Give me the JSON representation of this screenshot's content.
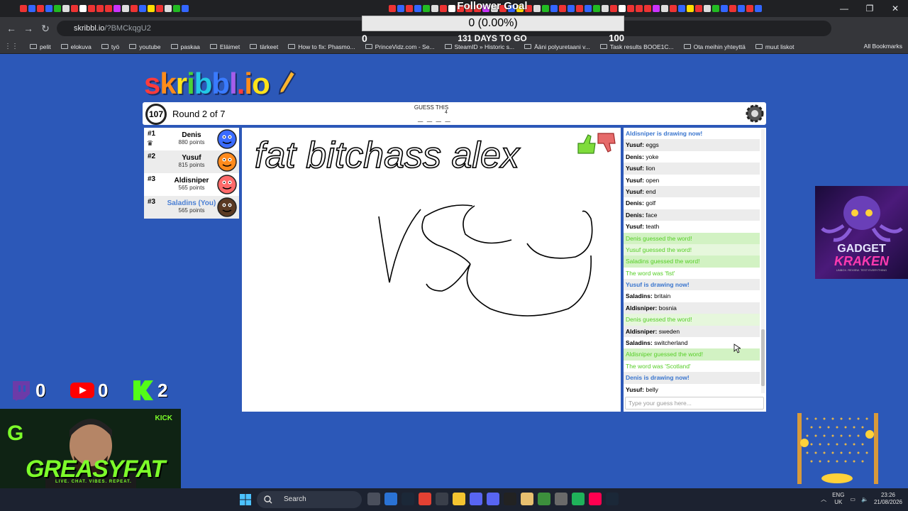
{
  "browser": {
    "url_domain": "skribbl.io",
    "url_path": "/?BMCkqgU2",
    "bookmarks": [
      "pelit",
      "elokuva",
      "työ",
      "youtube",
      "paskaa",
      "Eläimet",
      "tärkeet",
      "How to fix: Phasmo...",
      "PrinceVidz.com - Se...",
      "SteamID » Historic s...",
      "Ääni polyuretaani v...",
      "Task results BOOE1C...",
      "Ota meihin yhteyttä",
      "muut liskot"
    ],
    "all_bookmarks": "All Bookmarks"
  },
  "goal": {
    "title": "Follower Goal",
    "progress_text": "0 (0.00%)",
    "progress": 0,
    "min": "0",
    "days_left": "131 DAYS TO GO",
    "max": "100"
  },
  "game": {
    "logo": [
      "s",
      "k",
      "r",
      "i",
      "b",
      "b",
      "l",
      ".",
      "i",
      "o"
    ],
    "logo_colors": [
      "#ff3b3b",
      "#ff8c1a",
      "#ffe21a",
      "#4cd137",
      "#22c8e5",
      "#3a7bff",
      "#a55eea",
      "#ff3b3b",
      "#ff8c1a",
      "#ffe21a"
    ],
    "timer": "107",
    "round": "Round 2 of 7",
    "guess_label": "GUESS THIS",
    "letter_count": "4",
    "blanks": "_ _ _ _",
    "players": [
      {
        "rank": "#1",
        "name": "Denis",
        "points": "880 points",
        "crown": true,
        "color": "#3a6bff",
        "you": false
      },
      {
        "rank": "#2",
        "name": "Yusuf",
        "points": "815 points",
        "crown": false,
        "color": "#ff8a1c",
        "you": false
      },
      {
        "rank": "#3",
        "name": "Aldisniper",
        "points": "565 points",
        "crown": false,
        "color": "#ff6a6a",
        "you": false
      },
      {
        "rank": "#3",
        "name": "Saladins (You)",
        "points": "565 points",
        "crown": false,
        "color": "#5a3a24",
        "you": true
      }
    ],
    "canvas_text": "fat bitchass alex"
  },
  "chat": {
    "messages": [
      {
        "type": "draw",
        "text": "Aldisniper is drawing now!"
      },
      {
        "type": "msg",
        "user": "Yusuf:",
        "text": "eggs"
      },
      {
        "type": "msg",
        "user": "Denis:",
        "text": "yoke"
      },
      {
        "type": "msg",
        "user": "Yusuf:",
        "text": "lion"
      },
      {
        "type": "msg",
        "user": "Yusuf:",
        "text": "open"
      },
      {
        "type": "msg",
        "user": "Yusuf:",
        "text": "end"
      },
      {
        "type": "msg",
        "user": "Denis:",
        "text": "golf"
      },
      {
        "type": "msg",
        "user": "Denis:",
        "text": "face"
      },
      {
        "type": "msg",
        "user": "Yusuf:",
        "text": "teath"
      },
      {
        "type": "guessed",
        "text": "Denis guessed the word!"
      },
      {
        "type": "guessed",
        "text": "Yusuf guessed the word!"
      },
      {
        "type": "guessed",
        "text": "Saladins guessed the word!"
      },
      {
        "type": "word",
        "text": "The word was 'fist'"
      },
      {
        "type": "draw",
        "text": "Yusuf is drawing now!"
      },
      {
        "type": "msg",
        "user": "Saladins:",
        "text": "britain"
      },
      {
        "type": "msg",
        "user": "Aldisniper:",
        "text": "bosnia"
      },
      {
        "type": "guessed",
        "text": "Denis guessed the word!"
      },
      {
        "type": "msg",
        "user": "Aldisniper:",
        "text": "sweden"
      },
      {
        "type": "msg",
        "user": "Saladins:",
        "text": "switcherland"
      },
      {
        "type": "guessed",
        "text": "Aldisniper guessed the word!"
      },
      {
        "type": "word",
        "text": "The word was 'Scotland'"
      },
      {
        "type": "draw",
        "text": "Denis is drawing now!"
      },
      {
        "type": "msg",
        "user": "Yusuf:",
        "text": "belly"
      }
    ],
    "placeholder": "Type your guess here..."
  },
  "overlay": {
    "twitch_count": "0",
    "youtube_count": "0",
    "kick_count": "2",
    "streamer_name": "GREASYFAT",
    "streamer_tagline": "LIVE. CHAT. VIBES. REPEAT.",
    "kick_label": "KICK",
    "sponsor_line1": "GADGET",
    "sponsor_line2": "KRAKEN",
    "sponsor_tagline": "UNBOX. REVIEW. TEST EVERYTHING"
  },
  "taskbar": {
    "search": "Search",
    "lang": "ENG",
    "region": "UK",
    "time": "23:26",
    "date": "21/08/2026"
  }
}
